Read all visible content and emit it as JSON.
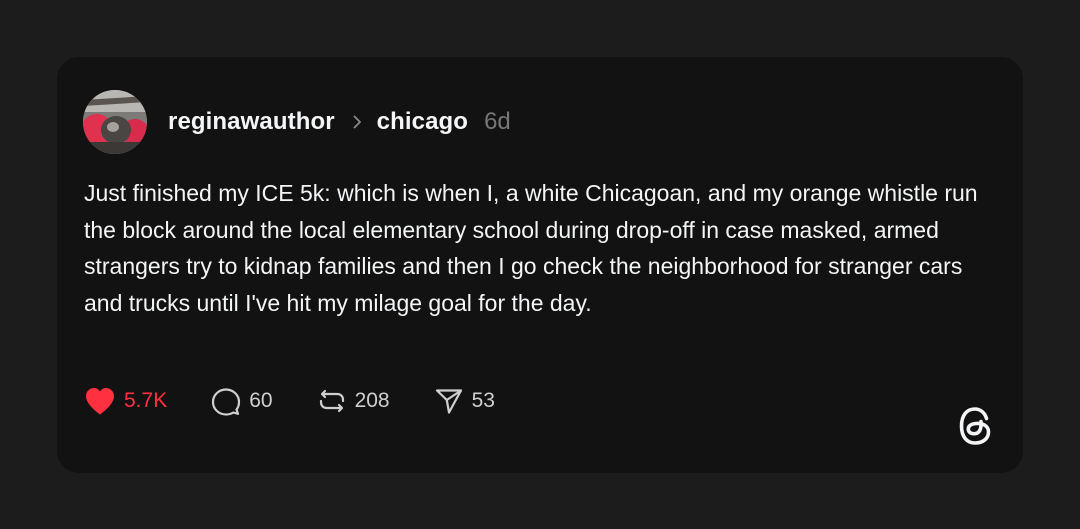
{
  "post": {
    "author": "reginawauthor",
    "community": "chicago",
    "time_ago": "6d",
    "text": "Just finished my ICE 5k: which is when I, a white Chicagoan, and my orange whistle run the block around the local elementary school during drop-off in case masked, armed strangers try to kidnap families and then I go check the neighborhood for stranger cars and trucks until I've hit my milage goal for the day.",
    "avatar_icon": "profile-photo"
  },
  "actions": {
    "like": {
      "icon": "heart-icon",
      "count": "5.7K",
      "liked": true,
      "color": "#ff3040"
    },
    "reply": {
      "icon": "comment-icon",
      "count": "60"
    },
    "repost": {
      "icon": "repost-icon",
      "count": "208"
    },
    "share": {
      "icon": "send-icon",
      "count": "53"
    }
  },
  "branding": {
    "icon": "threads-logo-icon"
  },
  "colors": {
    "page_background": "#1c1c1c",
    "card_background": "#121212",
    "primary_text": "#f3f5f7",
    "secondary_text": "#777777",
    "like_red": "#ff3040"
  }
}
